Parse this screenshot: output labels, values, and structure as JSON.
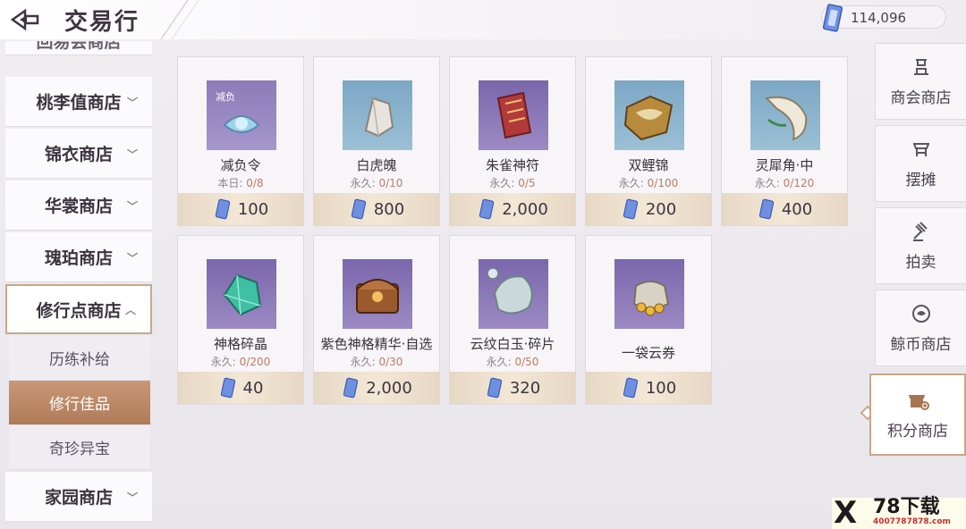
{
  "header": {
    "title": "交易行",
    "currency_amount": "114,096"
  },
  "leftnav": {
    "partial_item": "回易会商店",
    "items": [
      {
        "label": "桃李值商店"
      },
      {
        "label": "锦衣商店"
      },
      {
        "label": "华裳商店"
      },
      {
        "label": "瑰珀商店"
      },
      {
        "label": "修行点商店"
      },
      {
        "label": "家园商店"
      }
    ],
    "subitems": [
      {
        "label": "历练补给"
      },
      {
        "label": "修行佳品"
      },
      {
        "label": "奇珍异宝"
      }
    ]
  },
  "goods": [
    {
      "name": "减负令",
      "limit_label": "本日:",
      "limit_count": "0/8",
      "price": "100",
      "badge": "减负"
    },
    {
      "name": "白虎魄",
      "limit_label": "永久:",
      "limit_count": "0/10",
      "price": "800"
    },
    {
      "name": "朱雀神符",
      "limit_label": "永久:",
      "limit_count": "0/5",
      "price": "2,000"
    },
    {
      "name": "双鲤锦",
      "limit_label": "永久:",
      "limit_count": "0/100",
      "price": "200"
    },
    {
      "name": "灵犀角·中",
      "limit_label": "永久:",
      "limit_count": "0/120",
      "price": "400"
    },
    {
      "name": "神格碎晶",
      "limit_label": "永久:",
      "limit_count": "0/200",
      "price": "40"
    },
    {
      "name": "紫色神格精华·自选",
      "limit_label": "永久:",
      "limit_count": "0/30",
      "price": "2,000"
    },
    {
      "name": "云纹白玉·碎片",
      "limit_label": "永久:",
      "limit_count": "0/50",
      "price": "320"
    },
    {
      "name": "一袋云券",
      "limit_label": "",
      "limit_count": "",
      "price": "100"
    }
  ],
  "right_tabs": [
    {
      "label": "商会商店",
      "icon": "merchant-guild-icon"
    },
    {
      "label": "摆摊",
      "icon": "stall-icon"
    },
    {
      "label": "拍卖",
      "icon": "auction-hammer-icon"
    },
    {
      "label": "鲸币商店",
      "icon": "whale-coin-icon"
    },
    {
      "label": "积分商店",
      "icon": "points-shop-icon"
    }
  ],
  "watermark": {
    "x": "X",
    "big": "78下载",
    "small": "4007787878.com"
  },
  "colors": {
    "accent": "#c9a786",
    "active_sub": "#b07a58",
    "price_bar": "#f3e7d6",
    "limit_count": "#c07a63"
  }
}
